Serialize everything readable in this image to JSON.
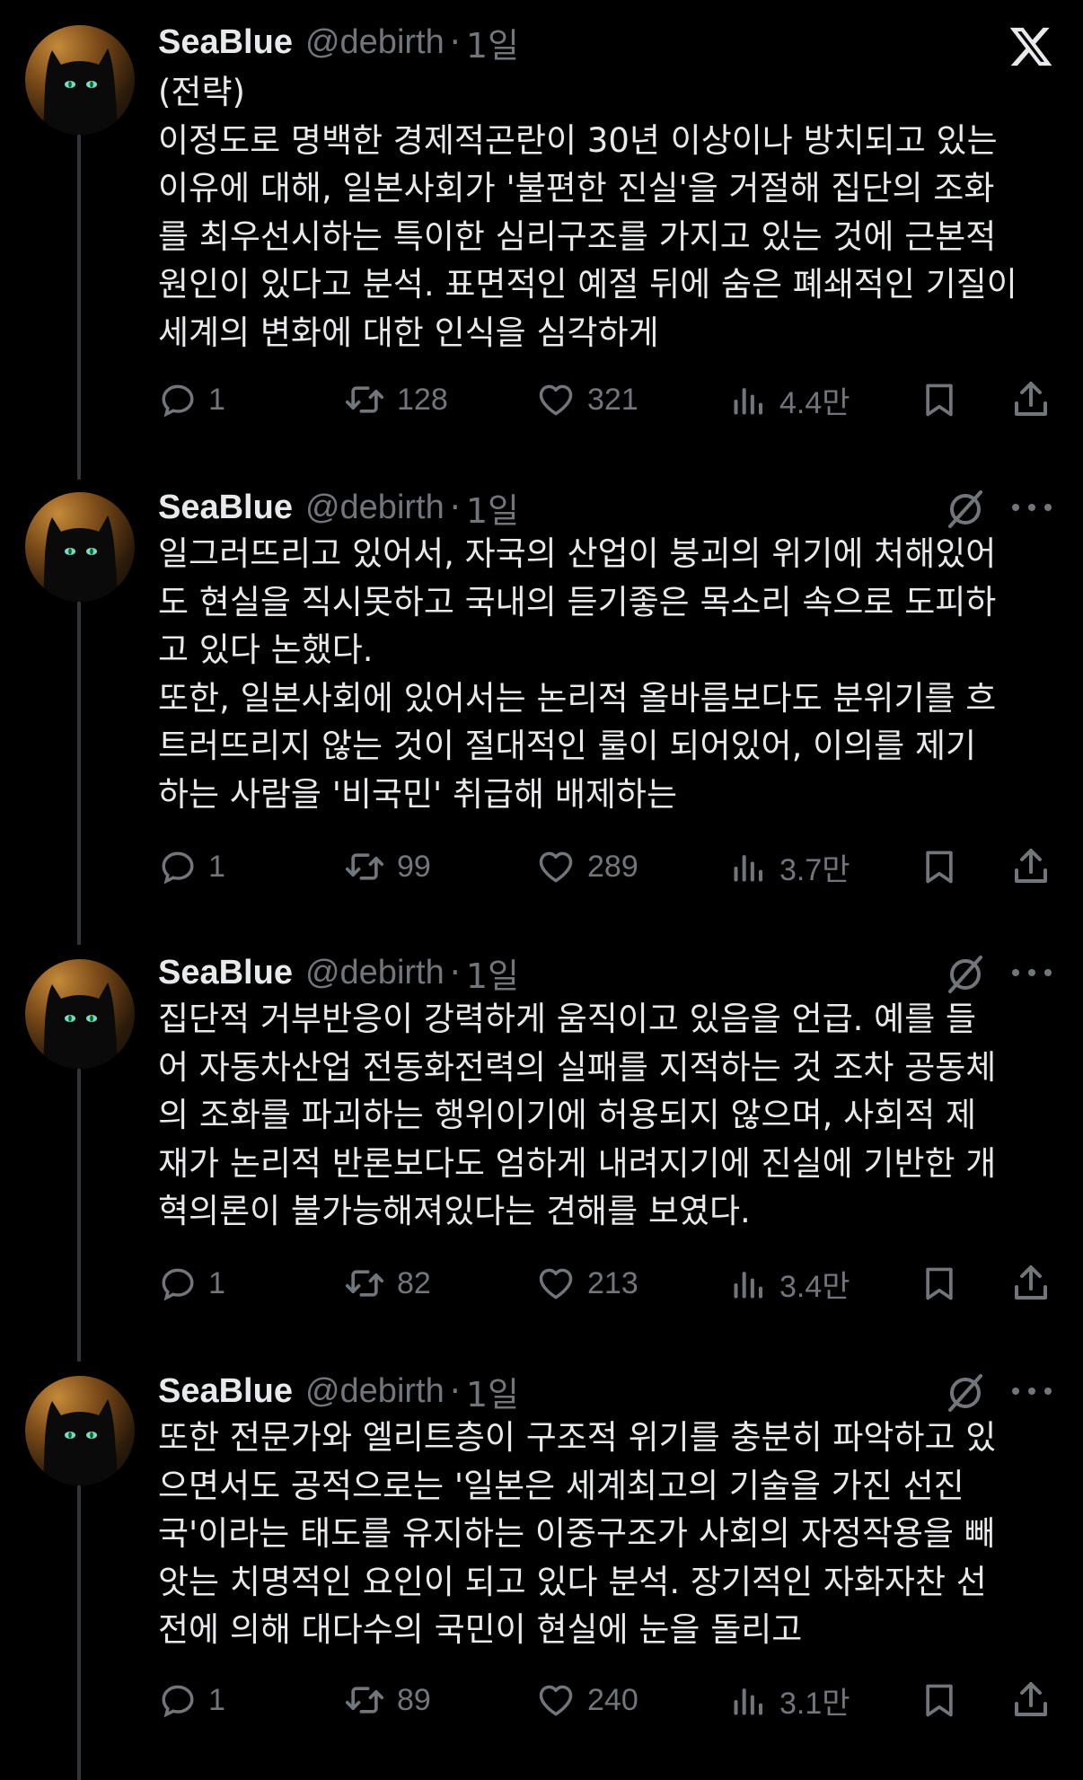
{
  "app": {
    "logo_icon": "x-logo-icon"
  },
  "author": {
    "name": "SeaBlue",
    "handle": "@debirth",
    "time": "1일"
  },
  "tweets": [
    {
      "lines": [
        "(전략)",
        "이정도로 명백한 경제적곤란이 30년 이상이나 방치되고 있는",
        "이유에 대해, 일본사회가 '불편한 진실'을 거절해 집단의 조화",
        "를 최우선시하는 특이한 심리구조를 가지고 있는 것에 근본적",
        "원인이 있다고 분석. 표면적인 예절 뒤에 숨은 폐쇄적인 기질이",
        "세계의 변화에 대한 인식을 심각하게"
      ],
      "replies": "1",
      "retweets": "128",
      "likes": "321",
      "views": "4.4만"
    },
    {
      "lines": [
        "일그러뜨리고 있어서, 자국의 산업이 붕괴의 위기에 처해있어",
        "도 현실을 직시못하고 국내의 듣기좋은 목소리 속으로 도피하",
        "고 있다 논했다.",
        "또한, 일본사회에 있어서는 논리적 올바름보다도 분위기를 흐",
        "트러뜨리지 않는 것이 절대적인 룰이 되어있어, 이의를 제기",
        "하는 사람을 '비국민' 취급해 배제하는"
      ],
      "replies": "1",
      "retweets": "99",
      "likes": "289",
      "views": "3.7만"
    },
    {
      "lines": [
        "집단적 거부반응이 강력하게 움직이고 있음을 언급. 예를 들",
        "어 자동차산업 전동화전력의 실패를 지적하는 것 조차 공동체",
        "의 조화를 파괴하는 행위이기에 허용되지 않으며, 사회적 제",
        "재가 논리적 반론보다도 엄하게 내려지기에 진실에 기반한 개",
        "혁의론이 불가능해져있다는 견해를 보였다."
      ],
      "replies": "1",
      "retweets": "82",
      "likes": "213",
      "views": "3.4만"
    },
    {
      "lines": [
        "또한 전문가와 엘리트층이 구조적 위기를 충분히 파악하고 있",
        "으면서도 공적으로는 '일본은 세계최고의 기술을 가진 선진",
        "국'이라는 태도를 유지하는 이중구조가 사회의 자정작용을 빼",
        "앗는 치명적인 요인이 되고 있다 분석. 장기적인 자화자찬 선",
        "전에 의해 대다수의 국민이 현실에 눈을 돌리고"
      ],
      "replies": "1",
      "retweets": "89",
      "likes": "240",
      "views": "3.1만"
    }
  ]
}
